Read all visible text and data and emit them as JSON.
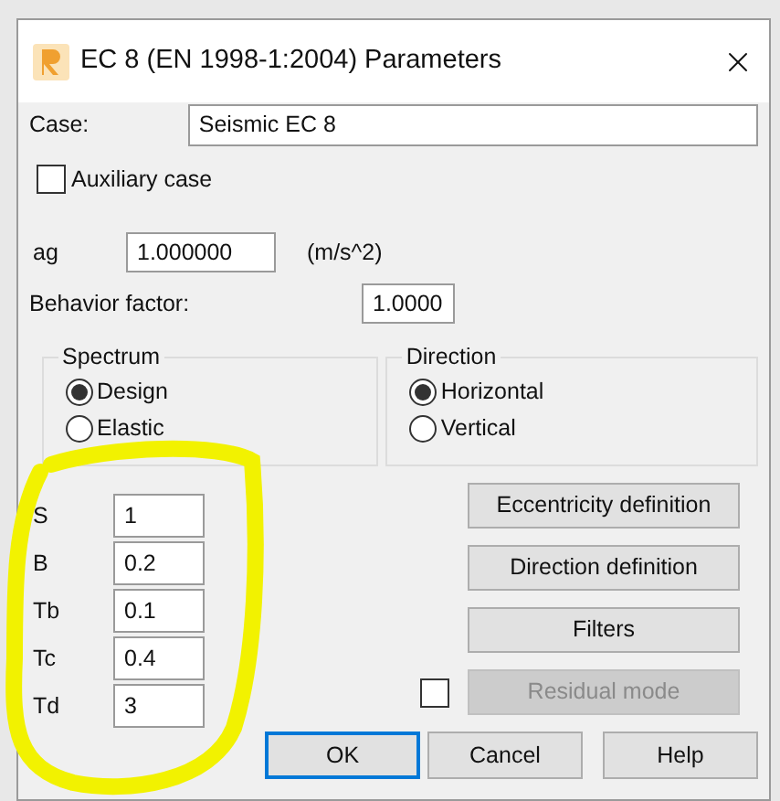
{
  "window": {
    "title": "EC 8 (EN 1998-1:2004) Parameters"
  },
  "case": {
    "label": "Case:",
    "value": "Seismic EC 8"
  },
  "auxiliary_case": {
    "label": "Auxiliary case",
    "checked": false
  },
  "ag": {
    "label": "ag",
    "value": "1.000000",
    "unit": "(m/s^2)"
  },
  "behavior_factor": {
    "label": "Behavior factor:",
    "value": "1.0000"
  },
  "spectrum": {
    "title": "Spectrum",
    "options": [
      {
        "label": "Design",
        "selected": true
      },
      {
        "label": "Elastic",
        "selected": false
      }
    ]
  },
  "direction": {
    "title": "Direction",
    "options": [
      {
        "label": "Horizontal",
        "selected": true
      },
      {
        "label": "Vertical",
        "selected": false
      }
    ]
  },
  "parameters": [
    {
      "label": "S",
      "value": "1"
    },
    {
      "label": "B",
      "value": "0.2"
    },
    {
      "label": "Tb",
      "value": "0.1"
    },
    {
      "label": "Tc",
      "value": "0.4"
    },
    {
      "label": "Td",
      "value": "3"
    }
  ],
  "side_buttons": [
    {
      "label": "Eccentricity definition",
      "disabled": false
    },
    {
      "label": "Direction definition",
      "disabled": false
    },
    {
      "label": "Filters",
      "disabled": false
    },
    {
      "label": "Residual mode",
      "disabled": true
    }
  ],
  "residual_checkbox": {
    "checked": false
  },
  "footer_buttons": [
    {
      "label": "OK",
      "default": true
    },
    {
      "label": "Cancel",
      "default": false
    },
    {
      "label": "Help",
      "default": false
    }
  ]
}
